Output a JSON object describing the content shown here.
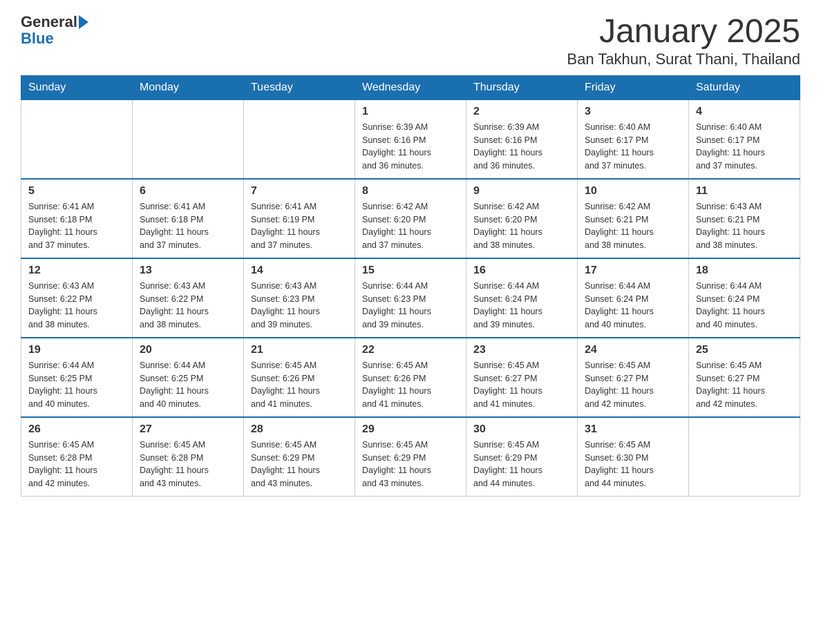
{
  "header": {
    "logo_text_general": "General",
    "logo_text_blue": "Blue",
    "month_title": "January 2025",
    "subtitle": "Ban Takhun, Surat Thani, Thailand"
  },
  "days_of_week": [
    "Sunday",
    "Monday",
    "Tuesday",
    "Wednesday",
    "Thursday",
    "Friday",
    "Saturday"
  ],
  "weeks": [
    [
      {
        "day": "",
        "info": ""
      },
      {
        "day": "",
        "info": ""
      },
      {
        "day": "",
        "info": ""
      },
      {
        "day": "1",
        "info": "Sunrise: 6:39 AM\nSunset: 6:16 PM\nDaylight: 11 hours\nand 36 minutes."
      },
      {
        "day": "2",
        "info": "Sunrise: 6:39 AM\nSunset: 6:16 PM\nDaylight: 11 hours\nand 36 minutes."
      },
      {
        "day": "3",
        "info": "Sunrise: 6:40 AM\nSunset: 6:17 PM\nDaylight: 11 hours\nand 37 minutes."
      },
      {
        "day": "4",
        "info": "Sunrise: 6:40 AM\nSunset: 6:17 PM\nDaylight: 11 hours\nand 37 minutes."
      }
    ],
    [
      {
        "day": "5",
        "info": "Sunrise: 6:41 AM\nSunset: 6:18 PM\nDaylight: 11 hours\nand 37 minutes."
      },
      {
        "day": "6",
        "info": "Sunrise: 6:41 AM\nSunset: 6:18 PM\nDaylight: 11 hours\nand 37 minutes."
      },
      {
        "day": "7",
        "info": "Sunrise: 6:41 AM\nSunset: 6:19 PM\nDaylight: 11 hours\nand 37 minutes."
      },
      {
        "day": "8",
        "info": "Sunrise: 6:42 AM\nSunset: 6:20 PM\nDaylight: 11 hours\nand 37 minutes."
      },
      {
        "day": "9",
        "info": "Sunrise: 6:42 AM\nSunset: 6:20 PM\nDaylight: 11 hours\nand 38 minutes."
      },
      {
        "day": "10",
        "info": "Sunrise: 6:42 AM\nSunset: 6:21 PM\nDaylight: 11 hours\nand 38 minutes."
      },
      {
        "day": "11",
        "info": "Sunrise: 6:43 AM\nSunset: 6:21 PM\nDaylight: 11 hours\nand 38 minutes."
      }
    ],
    [
      {
        "day": "12",
        "info": "Sunrise: 6:43 AM\nSunset: 6:22 PM\nDaylight: 11 hours\nand 38 minutes."
      },
      {
        "day": "13",
        "info": "Sunrise: 6:43 AM\nSunset: 6:22 PM\nDaylight: 11 hours\nand 38 minutes."
      },
      {
        "day": "14",
        "info": "Sunrise: 6:43 AM\nSunset: 6:23 PM\nDaylight: 11 hours\nand 39 minutes."
      },
      {
        "day": "15",
        "info": "Sunrise: 6:44 AM\nSunset: 6:23 PM\nDaylight: 11 hours\nand 39 minutes."
      },
      {
        "day": "16",
        "info": "Sunrise: 6:44 AM\nSunset: 6:24 PM\nDaylight: 11 hours\nand 39 minutes."
      },
      {
        "day": "17",
        "info": "Sunrise: 6:44 AM\nSunset: 6:24 PM\nDaylight: 11 hours\nand 40 minutes."
      },
      {
        "day": "18",
        "info": "Sunrise: 6:44 AM\nSunset: 6:24 PM\nDaylight: 11 hours\nand 40 minutes."
      }
    ],
    [
      {
        "day": "19",
        "info": "Sunrise: 6:44 AM\nSunset: 6:25 PM\nDaylight: 11 hours\nand 40 minutes."
      },
      {
        "day": "20",
        "info": "Sunrise: 6:44 AM\nSunset: 6:25 PM\nDaylight: 11 hours\nand 40 minutes."
      },
      {
        "day": "21",
        "info": "Sunrise: 6:45 AM\nSunset: 6:26 PM\nDaylight: 11 hours\nand 41 minutes."
      },
      {
        "day": "22",
        "info": "Sunrise: 6:45 AM\nSunset: 6:26 PM\nDaylight: 11 hours\nand 41 minutes."
      },
      {
        "day": "23",
        "info": "Sunrise: 6:45 AM\nSunset: 6:27 PM\nDaylight: 11 hours\nand 41 minutes."
      },
      {
        "day": "24",
        "info": "Sunrise: 6:45 AM\nSunset: 6:27 PM\nDaylight: 11 hours\nand 42 minutes."
      },
      {
        "day": "25",
        "info": "Sunrise: 6:45 AM\nSunset: 6:27 PM\nDaylight: 11 hours\nand 42 minutes."
      }
    ],
    [
      {
        "day": "26",
        "info": "Sunrise: 6:45 AM\nSunset: 6:28 PM\nDaylight: 11 hours\nand 42 minutes."
      },
      {
        "day": "27",
        "info": "Sunrise: 6:45 AM\nSunset: 6:28 PM\nDaylight: 11 hours\nand 43 minutes."
      },
      {
        "day": "28",
        "info": "Sunrise: 6:45 AM\nSunset: 6:29 PM\nDaylight: 11 hours\nand 43 minutes."
      },
      {
        "day": "29",
        "info": "Sunrise: 6:45 AM\nSunset: 6:29 PM\nDaylight: 11 hours\nand 43 minutes."
      },
      {
        "day": "30",
        "info": "Sunrise: 6:45 AM\nSunset: 6:29 PM\nDaylight: 11 hours\nand 44 minutes."
      },
      {
        "day": "31",
        "info": "Sunrise: 6:45 AM\nSunset: 6:30 PM\nDaylight: 11 hours\nand 44 minutes."
      },
      {
        "day": "",
        "info": ""
      }
    ]
  ]
}
